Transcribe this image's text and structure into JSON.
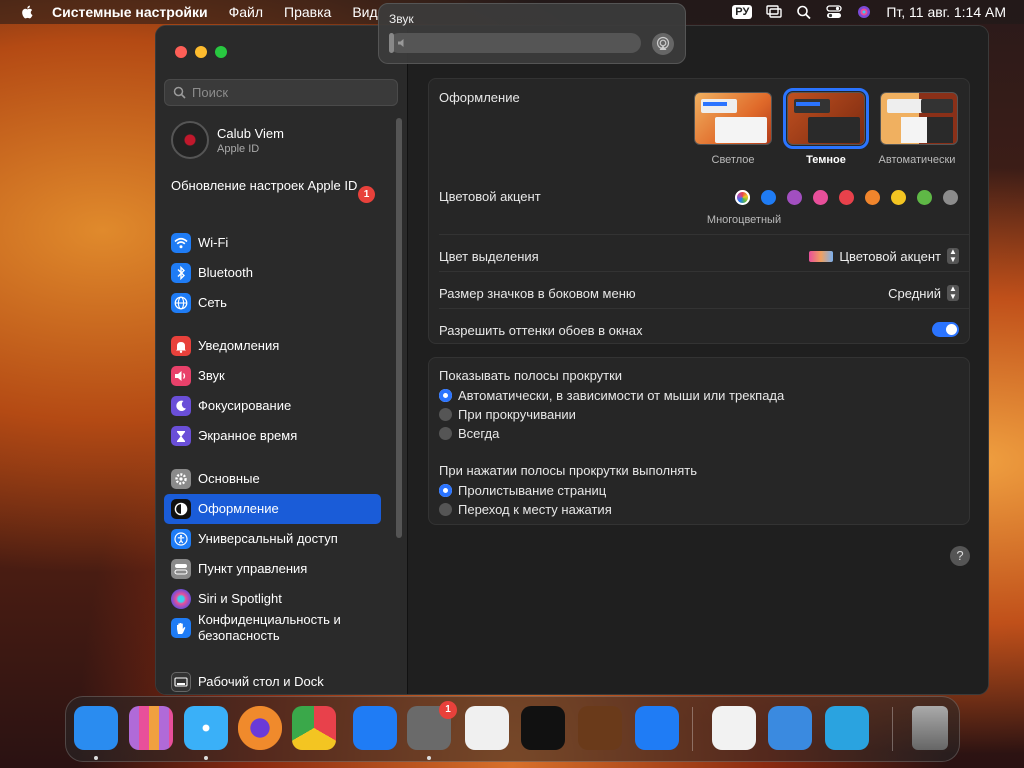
{
  "menubar": {
    "app_name": "Системные настройки",
    "menus": [
      "Файл",
      "Правка",
      "Вид"
    ],
    "input_source": "РУ",
    "datetime": "Пт, 11 авг. 1:14 AM"
  },
  "volume_hud": {
    "title": "Звук",
    "level": 0.02
  },
  "sidebar": {
    "search_placeholder": "Поиск",
    "account": {
      "name": "Calub Viem",
      "subtitle": "Apple ID"
    },
    "update": {
      "label": "Обновление настроек Apple ID",
      "badge": "1"
    },
    "items": [
      {
        "label": "Wi-Fi",
        "icon": "wifi-icon",
        "color": "#1f7cf5"
      },
      {
        "label": "Bluetooth",
        "icon": "bluetooth-icon",
        "color": "#1f7cf5"
      },
      {
        "label": "Сеть",
        "icon": "globe-icon",
        "color": "#1f7cf5"
      },
      {
        "label": "Уведомления",
        "icon": "bell-icon",
        "color": "#e8413b"
      },
      {
        "label": "Звук",
        "icon": "speaker-icon",
        "color": "#e8416a"
      },
      {
        "label": "Фокусирование",
        "icon": "moon-icon",
        "color": "#6a4fd8"
      },
      {
        "label": "Экранное время",
        "icon": "hourglass-icon",
        "color": "#6a4fd8"
      },
      {
        "label": "Основные",
        "icon": "gear-icon",
        "color": "#8a8a8a"
      },
      {
        "label": "Оформление",
        "icon": "appearance-icon",
        "color": "#111111"
      },
      {
        "label": "Универсальный доступ",
        "icon": "accessibility-icon",
        "color": "#1f7cf5"
      },
      {
        "label": "Пункт управления",
        "icon": "control-center-icon",
        "color": "#8a8a8a"
      },
      {
        "label": "Siri и Spotlight",
        "icon": "siri-icon",
        "color": "#b04ad8"
      },
      {
        "label": "Конфиденциальность и безопасность",
        "icon": "hand-icon",
        "color": "#1f7cf5"
      },
      {
        "label": "Рабочий стол и Dock",
        "icon": "dock-icon",
        "color": "#333333"
      }
    ],
    "active_index": 8
  },
  "appearance": {
    "label": "Оформление",
    "options": [
      {
        "label": "Светлое"
      },
      {
        "label": "Темное"
      },
      {
        "label": "Автоматически"
      }
    ],
    "selected_index": 1
  },
  "accent": {
    "label": "Цветовой акцент",
    "caption": "Многоцветный",
    "colors": [
      "#1f7cf5",
      "#a24fc0",
      "#e84f9a",
      "#e8414b",
      "#f0852c",
      "#f3c522",
      "#5fb846",
      "#8c8c8c"
    ]
  },
  "highlight": {
    "label": "Цвет выделения",
    "value": "Цветовой акцент"
  },
  "icon_size": {
    "label": "Размер значков в боковом меню",
    "value": "Средний"
  },
  "wallpaper_tint": {
    "label": "Разрешить оттенки обоев в окнах",
    "on": true
  },
  "scrollbars": {
    "label": "Показывать полосы прокрутки",
    "options": [
      "Автоматически, в зависимости от мыши или трекпада",
      "При прокручивании",
      "Всегда"
    ],
    "selected_index": 0
  },
  "click_scroll": {
    "label": "При нажатии полосы прокрутки выполнять",
    "options": [
      "Пролистывание страниц",
      "Переход к месту нажатия"
    ],
    "selected_index": 0
  },
  "help": "?",
  "dock": {
    "apps": [
      {
        "name": "finder",
        "color": "#2a8cf0"
      },
      {
        "name": "launchpad",
        "color": "#7a7a8a"
      },
      {
        "name": "safari",
        "color": "#2a9cf0"
      },
      {
        "name": "firefox",
        "color": "#e8602a"
      },
      {
        "name": "chrome",
        "color": "#f2f2f2"
      },
      {
        "name": "app-store",
        "color": "#1f7cf5"
      },
      {
        "name": "system-settings",
        "color": "#6a6a6a",
        "badge": "1"
      },
      {
        "name": "textedit",
        "color": "#f0f0f0"
      },
      {
        "name": "terminal",
        "color": "#111111"
      },
      {
        "name": "garageband",
        "color": "#6a3a1a"
      },
      {
        "name": "vscode",
        "color": "#1f7cf5"
      },
      {
        "name": "visual-studio",
        "color": "#f2f2f2"
      },
      {
        "name": "weather",
        "color": "#3a8ae0"
      },
      {
        "name": "telegram",
        "color": "#2aa3e0"
      },
      {
        "name": "trash",
        "color": "#888888"
      }
    ]
  }
}
